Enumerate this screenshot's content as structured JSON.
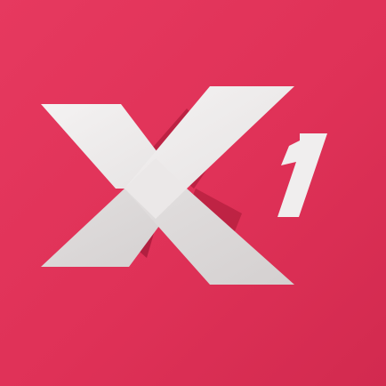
{
  "app_icon": {
    "logo_text": "X1",
    "colors": {
      "background": "#e13459",
      "background_dark": "#d22a4f",
      "shadow": "#b5203f",
      "shadow_deep": "#a31a38",
      "letter_light": "#f2f0f0",
      "letter_mid": "#e4e1e1",
      "letter_dark": "#d6d2d2"
    }
  }
}
